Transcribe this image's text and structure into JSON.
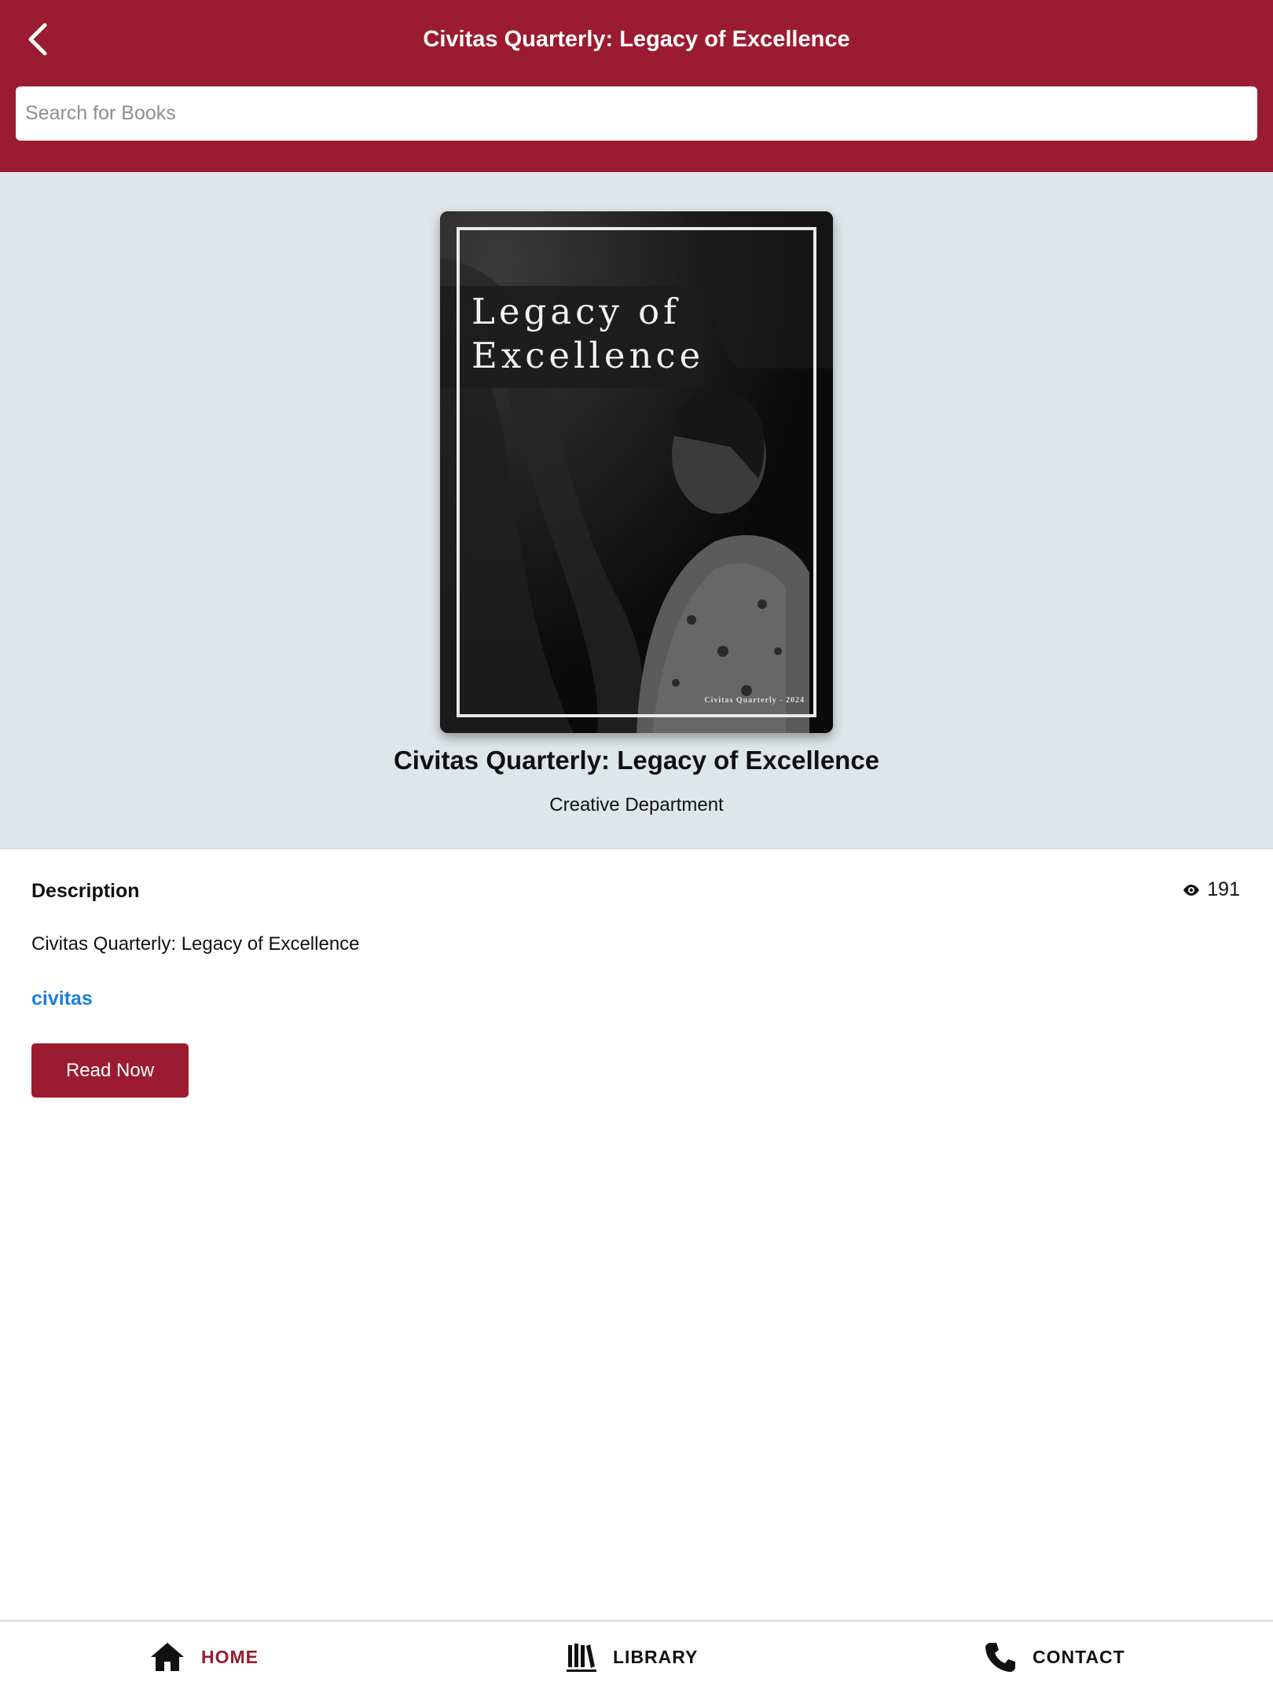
{
  "header": {
    "title": "Civitas Quarterly: Legacy of Excellence",
    "back_icon": "chevron-left-icon"
  },
  "search": {
    "placeholder": "Search for Books",
    "value": ""
  },
  "book": {
    "cover_title": "Legacy of\nExcellence",
    "cover_caption": "Civitas Quarterly - 2024",
    "title": "Civitas Quarterly: Legacy of Excellence",
    "author": "Creative Department"
  },
  "details": {
    "heading": "Description",
    "views": "191",
    "views_icon": "eye-icon",
    "description": "Civitas Quarterly: Legacy of Excellence",
    "tag": "civitas",
    "read_button": "Read Now"
  },
  "nav": {
    "items": [
      {
        "label": "HOME",
        "icon": "home-icon",
        "active": true
      },
      {
        "label": "LIBRARY",
        "icon": "library-icon",
        "active": false
      },
      {
        "label": "CONTACT",
        "icon": "phone-icon",
        "active": false
      }
    ]
  },
  "colors": {
    "brand": "#9b1b30",
    "hero_bg": "#dfe6e9",
    "link": "#1a7fd9"
  }
}
